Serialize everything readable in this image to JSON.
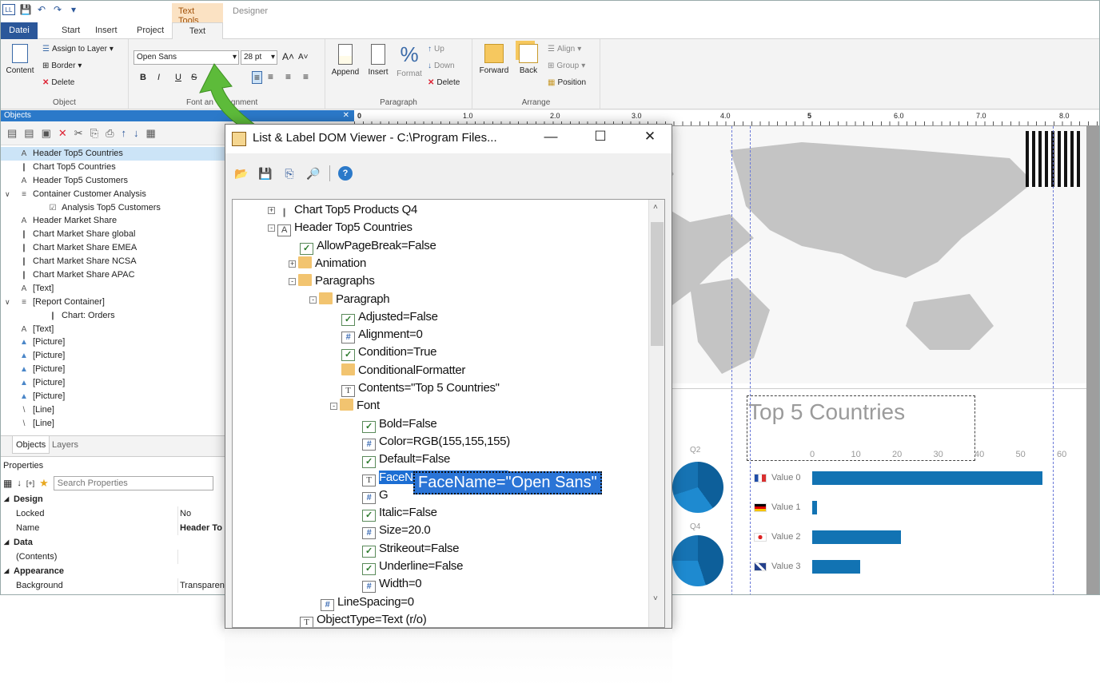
{
  "ribbon_tabs": {
    "contextual": "Text Tools",
    "designer": "Designer",
    "tabs": [
      "Datei",
      "Start",
      "Insert",
      "Project",
      "Text"
    ]
  },
  "ribbon": {
    "object_group": {
      "content": "Content",
      "assign_layer": "Assign to Layer",
      "border": "Border",
      "delete": "Delete",
      "label": "Object"
    },
    "font_group": {
      "font_name": "Open Sans",
      "font_size": "28 pt",
      "label_visible": "Font an",
      "label_visible_end": "gnment",
      "bold": "B",
      "italic": "I",
      "underline": "U",
      "strike": "S"
    },
    "paragraph_group": {
      "append": "Append",
      "insert": "Insert",
      "format": "Format",
      "up": "Up",
      "down": "Down",
      "delete": "Delete",
      "label": "Paragraph"
    },
    "arrange_group": {
      "forward": "Forward",
      "back": "Back",
      "align": "Align",
      "group": "Group",
      "position": "Position",
      "label": "Arrange"
    }
  },
  "objects_panel": {
    "title": "Objects",
    "items": [
      {
        "icon": "A",
        "label": "Header Top5 Countries",
        "indent": 0,
        "selected": true
      },
      {
        "icon": "chart",
        "label": "Chart Top5 Countries",
        "indent": 0
      },
      {
        "icon": "A",
        "label": "Header Top5 Customers",
        "indent": 0
      },
      {
        "icon": "container",
        "label": "Container Customer Analysis",
        "indent": 0
      },
      {
        "icon": "table",
        "label": "Analysis Top5 Customers",
        "indent": 1
      },
      {
        "icon": "A",
        "label": "Header Market Share",
        "indent": 0
      },
      {
        "icon": "chart",
        "label": "Chart Market Share global",
        "indent": 0
      },
      {
        "icon": "chart",
        "label": "Chart Market Share EMEA",
        "indent": 0
      },
      {
        "icon": "chart",
        "label": "Chart Market Share NCSA",
        "indent": 0
      },
      {
        "icon": "chart",
        "label": "Chart Market Share APAC",
        "indent": 0
      },
      {
        "icon": "A",
        "label": "[Text]",
        "indent": 0
      },
      {
        "icon": "container",
        "label": "[Report Container]",
        "indent": 0
      },
      {
        "icon": "chart",
        "label": "Chart: Orders",
        "indent": 1
      },
      {
        "icon": "A",
        "label": "[Text]",
        "indent": 0
      },
      {
        "icon": "picture",
        "label": "[Picture]",
        "indent": 0
      },
      {
        "icon": "picture",
        "label": "[Picture]",
        "indent": 0
      },
      {
        "icon": "picture",
        "label": "[Picture]",
        "indent": 0
      },
      {
        "icon": "picture",
        "label": "[Picture]",
        "indent": 0
      },
      {
        "icon": "picture",
        "label": "[Picture]",
        "indent": 0
      },
      {
        "icon": "line",
        "label": "[Line]",
        "indent": 0
      },
      {
        "icon": "line",
        "label": "[Line]",
        "indent": 0
      }
    ],
    "tabs": [
      "Objects",
      "Layers"
    ]
  },
  "properties": {
    "title": "Properties",
    "search_placeholder": "Search Properties",
    "rows": [
      {
        "type": "cat",
        "key": "Design"
      },
      {
        "type": "prop",
        "key": "Locked",
        "value": "No"
      },
      {
        "type": "prop",
        "key": "Name",
        "value": "Header To"
      },
      {
        "type": "cat",
        "key": "Data"
      },
      {
        "type": "prop",
        "key": "(Contents)",
        "value": ""
      },
      {
        "type": "cat",
        "key": "Appearance"
      },
      {
        "type": "prop",
        "key": "Background",
        "value": "Transparent"
      }
    ]
  },
  "ruler": {
    "labels": [
      "0",
      "1.0",
      "2.0",
      "3.0",
      "4.0",
      "5",
      "6.0",
      "7.0",
      "8.0"
    ]
  },
  "canvas": {
    "chart_title": "Top 5 Countries",
    "axis": [
      "0",
      "10",
      "20",
      "30",
      "40",
      "50",
      "60"
    ],
    "quarters": [
      "Q2",
      "Q4"
    ],
    "values": [
      {
        "label": "Value 0",
        "flag": "fr",
        "fraction": 0.96
      },
      {
        "label": "Value 1",
        "flag": "de",
        "fraction": 0.02
      },
      {
        "label": "Value 2",
        "flag": "jp",
        "fraction": 0.37
      },
      {
        "label": "Value 3",
        "flag": "uk",
        "fraction": 0.2
      }
    ]
  },
  "dialog": {
    "title": "List & Label DOM Viewer - C:\\Program Files...",
    "tree": [
      {
        "icon": "chart",
        "label": "Chart Top5 Products Q4",
        "level": 0,
        "exp": "+"
      },
      {
        "icon": "A",
        "label": "Header Top5 Countries",
        "level": 0,
        "exp": "-"
      },
      {
        "icon": "chk",
        "label": "AllowPageBreak=False",
        "level": 1
      },
      {
        "icon": "folder",
        "label": "Animation",
        "level": 1,
        "exp": "+"
      },
      {
        "icon": "folder",
        "label": "Paragraphs",
        "level": 1,
        "exp": "-"
      },
      {
        "icon": "folder",
        "label": "Paragraph",
        "level": 2,
        "exp": "-"
      },
      {
        "icon": "chk",
        "label": "Adjusted=False",
        "level": 3
      },
      {
        "icon": "hash",
        "label": "Alignment=0",
        "level": 3
      },
      {
        "icon": "chk",
        "label": "Condition=True",
        "level": 3
      },
      {
        "icon": "folder",
        "label": "ConditionalFormatter",
        "level": 3
      },
      {
        "icon": "txt",
        "label": "Contents=\"Top 5 Countries\"",
        "level": 3
      },
      {
        "icon": "folder",
        "label": "Font",
        "level": 3,
        "exp": "-"
      },
      {
        "icon": "chk",
        "label": "Bold=False",
        "level": 4
      },
      {
        "icon": "hash",
        "label": "Color=RGB(155,155,155)",
        "level": 4
      },
      {
        "icon": "chk",
        "label": "Default=False",
        "level": 4
      },
      {
        "icon": "txt",
        "label": "FaceName=\"Open Sans\"",
        "level": 4,
        "hl": true
      },
      {
        "icon": "hash",
        "label": "G",
        "level": 4
      },
      {
        "icon": "chk",
        "label": "Italic=False",
        "level": 4
      },
      {
        "icon": "hash",
        "label": "Size=20.0",
        "level": 4
      },
      {
        "icon": "chk",
        "label": "Strikeout=False",
        "level": 4
      },
      {
        "icon": "chk",
        "label": "Underline=False",
        "level": 4
      },
      {
        "icon": "hash",
        "label": "Width=0",
        "level": 4
      },
      {
        "icon": "hash",
        "label": "LineSpacing=0",
        "level": 2
      },
      {
        "icon": "txt",
        "label": "ObjectType=Text (r/o)",
        "level": 1
      }
    ],
    "tooltip": "FaceName=\"Open Sans\""
  },
  "colors": {
    "accent": "#2b579a",
    "panel_header": "#2b79c9",
    "bar": "#1273b3",
    "arrow": "#5dbb3a"
  }
}
